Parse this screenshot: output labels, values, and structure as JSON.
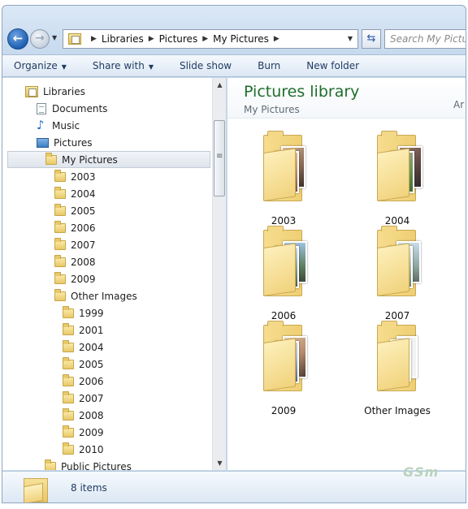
{
  "address": {
    "crumbs": [
      "Libraries",
      "Pictures",
      "My Pictures"
    ]
  },
  "search": {
    "placeholder": "Search My Pictures"
  },
  "toolbar": {
    "organize": "Organize",
    "share_with": "Share with",
    "slide_show": "Slide show",
    "burn": "Burn",
    "new_folder": "New folder"
  },
  "nav": {
    "libraries": "Libraries",
    "documents": "Documents",
    "music": "Music",
    "pictures": "Pictures",
    "my_pictures": "My Pictures",
    "years": [
      "2003",
      "2004",
      "2005",
      "2006",
      "2007",
      "2008",
      "2009"
    ],
    "other_images": "Other Images",
    "other_years": [
      "1999",
      "2001",
      "2004",
      "2005",
      "2006",
      "2007",
      "2008",
      "2009",
      "2010"
    ],
    "public_pictures": "Public Pictures"
  },
  "library": {
    "title": "Pictures library",
    "subtitle": "My Pictures",
    "arrange_cut": "Ar"
  },
  "folders": [
    "2003",
    "2004",
    "2006",
    "2007",
    "2009",
    "Other Images"
  ],
  "details": {
    "count": "8 items"
  },
  "watermark": "GSm"
}
